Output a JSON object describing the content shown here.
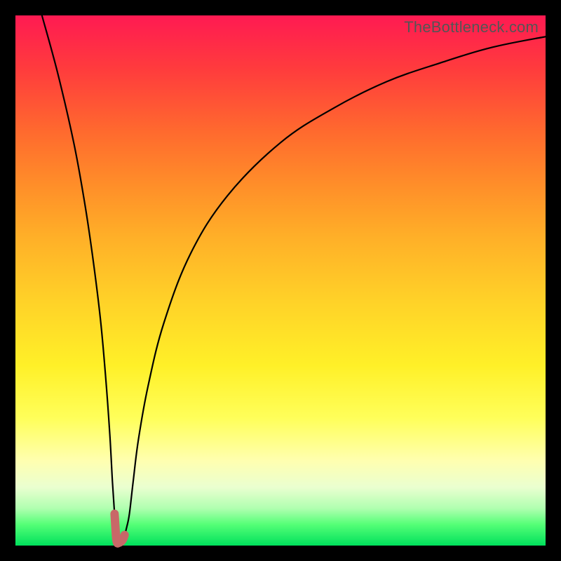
{
  "watermark": "TheBottleneck.com",
  "chart_data": {
    "type": "line",
    "title": "",
    "xlabel": "",
    "ylabel": "",
    "xlim": [
      0,
      100
    ],
    "ylim": [
      0,
      100
    ],
    "x": [
      5,
      8,
      11,
      13,
      14.5,
      16,
      17,
      17.8,
      18.3,
      18.7,
      19,
      19.2,
      19.4,
      19.7,
      20,
      20.3,
      20.6,
      21,
      21.5,
      22.2,
      23.2,
      25,
      28,
      33,
      40,
      50,
      60,
      70,
      80,
      90,
      100
    ],
    "values": [
      100,
      89,
      76,
      65,
      55,
      43,
      32,
      21,
      12,
      6,
      1.5,
      0.5,
      0.5,
      0.6,
      0.8,
      1.2,
      2,
      3.5,
      6,
      12,
      20,
      30,
      42,
      55,
      66,
      76,
      82.5,
      87.5,
      91,
      94,
      96
    ],
    "highlight": {
      "x_range": [
        18.6,
        20.6
      ],
      "y_range": [
        0.3,
        2.3
      ]
    },
    "colors": {
      "gradient_top": "#ff1a52",
      "gradient_mid": "#ffe028",
      "gradient_bottom": "#00e05c",
      "curve": "#000000",
      "highlight": "#c86868"
    }
  }
}
